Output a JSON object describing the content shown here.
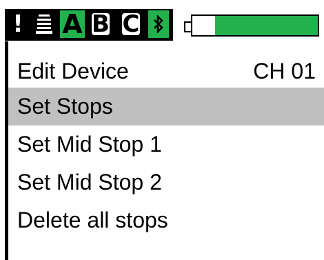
{
  "status_bar": {
    "alert_icon": "exclamation-icon",
    "lines_icon": "stacked-lines-icon",
    "channel_a": "A",
    "channel_b": "B",
    "channel_c": "C",
    "bluetooth_icon": "bluetooth-icon",
    "active_color": "#22b14c",
    "battery_level": 0.82
  },
  "header": {
    "title": "Edit Device",
    "channel": "CH 01"
  },
  "menu": {
    "items": [
      {
        "label": "Set Stops",
        "selected": true
      },
      {
        "label": "Set Mid Stop 1",
        "selected": false
      },
      {
        "label": "Set Mid Stop 2",
        "selected": false
      },
      {
        "label": "Delete all stops",
        "selected": false
      }
    ]
  },
  "colors": {
    "selection": "#c0c0c0",
    "foreground": "#000000",
    "background": "#ffffff"
  }
}
